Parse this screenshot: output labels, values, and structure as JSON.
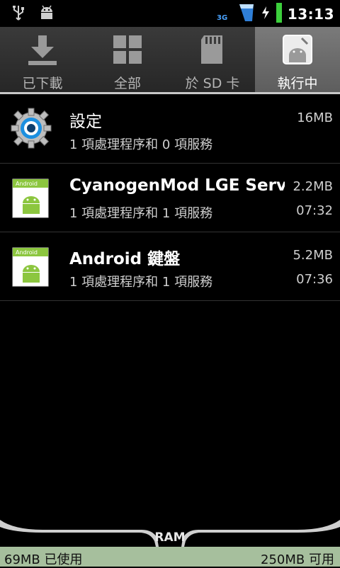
{
  "status_bar": {
    "icons": [
      "usb-icon",
      "android-debug-icon",
      "signal-icon",
      "charging-icon",
      "battery-icon"
    ],
    "network": "3G",
    "time": "13:13"
  },
  "tabs": [
    {
      "label": "已下載",
      "icon": "download-icon",
      "selected": false
    },
    {
      "label": "全部",
      "icon": "grid-icon",
      "selected": false
    },
    {
      "label": "於 SD 卡",
      "icon": "sd-card-icon",
      "selected": false
    },
    {
      "label": "執行中",
      "icon": "running-android-icon",
      "selected": true
    }
  ],
  "apps": [
    {
      "name": "設定",
      "detail": "1 項處理程序和 0 項服務",
      "size": "16MB",
      "time": "",
      "icon": "settings-gear-icon"
    },
    {
      "name": "CyanogenMod LGE Serv",
      "detail": "1 項處理程序和 1 項服務",
      "size": "2.2MB",
      "time": "07:32",
      "icon": "android-app-icon"
    },
    {
      "name": "Android 鍵盤",
      "detail": "1 項處理程序和 1 項服務",
      "size": "5.2MB",
      "time": "07:36",
      "icon": "android-app-icon"
    }
  ],
  "ram": {
    "label": "RAM",
    "used": "69MB 已使用",
    "available": "250MB 可用",
    "used_fraction": 0.0
  },
  "colors": {
    "ram_bar": "#a6bf9d",
    "settings_blue": "#1b8fe0",
    "android_green": "#8cc63f"
  }
}
